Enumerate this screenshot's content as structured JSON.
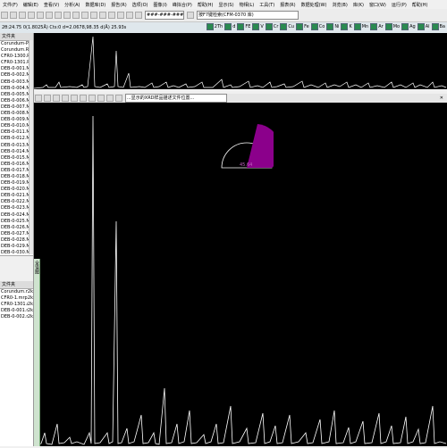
{
  "menu": [
    "文件(F)",
    "编辑(E)",
    "查看(V)",
    "分析(A)",
    "数据库(D)",
    "报告(R)",
    "选项(O)",
    "图像(I)",
    "峰拟合(P)",
    "帮助(H)",
    "显示(S)",
    "物相(L)",
    "工具(T)",
    "报表(R)",
    "数据处理(W)",
    "浏览(B)",
    "库(K)",
    "窗口(W)",
    "运行(P)",
    "帮助(H)"
  ],
  "toolbar": {
    "index_input": "###-###-####",
    "search_text": "按F7键检索(CFM-0370 库)"
  },
  "status": {
    "readout": "2θ:24.75 0(1.8025Å) Cts:0 d=2.0678,98.35 d(Å) 25.93s",
    "peak_toggles": [
      "2Th",
      "d",
      "FE",
      "V",
      "Cr",
      "Cu",
      "Fe",
      "Co",
      "Ni",
      "K",
      "Mn",
      "Ar",
      "Mo",
      "Ag",
      "Al",
      "Ba"
    ]
  },
  "left_panel": {
    "top_header": "文件夹",
    "files": [
      "Corundum-P.raw",
      "Corundum.RAW",
      "CFR0-1300.RAW",
      "CFR0-1301.RAW",
      "DEB-0-001.MDI",
      "DEB-0-002.MDI",
      "DEB-0-003.MDI",
      "DEB-0-004.MDI",
      "DEB-0-005.MDI",
      "DEB-0-006.MDI",
      "DEB-0-007.MDI",
      "DEB-0-008.MDI",
      "DEB-0-009.MDI",
      "DEB-0-010.MDI",
      "DEB-0-011.MDI",
      "DEB-0-012.MDI",
      "DEB-0-013.MDI",
      "DEB-0-014.MDI",
      "DEB-0-015.MDI",
      "DEB-0-016.MDI",
      "DEB-0-017.MDI",
      "DEB-0-018.MDI",
      "DEB-0-019.MDI",
      "DEB-0-020.MDI",
      "DEB-0-021.MDI",
      "DEB-0-022.MDI",
      "DEB-0-023.MDI",
      "DEB-0-024.MDI",
      "DEB-0-025.MDI",
      "DEB-0-026.MDI",
      "DEB-0-027.MDI",
      "DEB-0-028.MDI",
      "DEB-0-029.MDI",
      "DEB-0-030.MDI"
    ],
    "bottom_header": "文件夹",
    "bottom_files": [
      {
        "name": "Corundum.mrpl",
        "size": "2k"
      },
      {
        "name": "CFR0-1.mrpl",
        "size": "2k"
      },
      {
        "name": "CFR0-1301.mrpl",
        "size": "2k"
      },
      {
        "name": "DEB-0-001.mrpl",
        "size": "2k"
      },
      {
        "name": "DEB-0-002.mrpl",
        "size": "2k"
      }
    ]
  },
  "subtoolbar": {
    "title": "...显示的XRD样品描述文件位置..."
  },
  "inset": {
    "label": "45.64"
  },
  "vtab_label": "全谱图"
}
